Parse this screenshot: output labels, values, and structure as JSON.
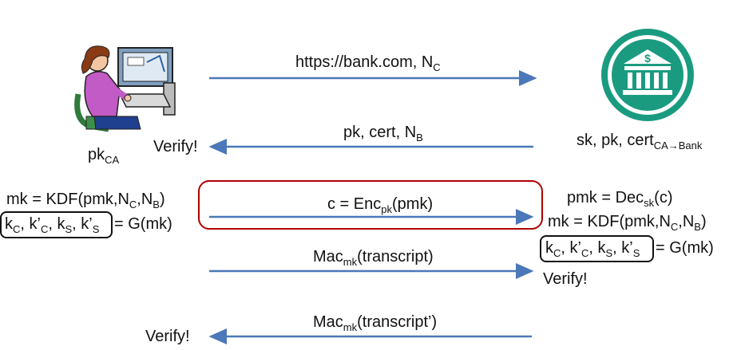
{
  "client": {
    "key_base": "pk",
    "key_sub": "CA",
    "verify_label": "Verify!",
    "mk_expr": {
      "pre": "mk = KDF(pmk,N",
      "s1": "C",
      "mid": ",N",
      "s2": "B",
      "post": ")"
    },
    "keys_expr": {
      "k1": "k",
      "k1s": "C",
      "k2": ", k’",
      "k2s": "C",
      "k3": ", k",
      "k3s": "S",
      "k4": ", k’",
      "k4s": "S",
      "rest": "= G(mk)"
    },
    "final_verify_label": "Verify!"
  },
  "bank": {
    "keys_label": {
      "pre": "sk, pk, cert",
      "sub": "CA→Bank"
    },
    "pmk_expr": {
      "pre": "pmk = Dec",
      "sub": "sk",
      "post": "(c)"
    },
    "mk_expr": {
      "pre": "mk = KDF(pmk,N",
      "s1": "C",
      "mid": ",N",
      "s2": "B",
      "post": ")"
    },
    "keys_expr": {
      "k1": "k",
      "k1s": "C",
      "k2": ", k’",
      "k2s": "C",
      "k3": ", k",
      "k3s": "S",
      "k4": ", k’",
      "k4s": "S",
      "rest": "= G(mk)"
    },
    "verify_label": "Verify!"
  },
  "messages": [
    {
      "dir": "right",
      "text": {
        "pre": "https://bank.com, N",
        "sub": "C",
        "post": ""
      }
    },
    {
      "dir": "left",
      "text": {
        "pre": "pk, cert, N",
        "sub": "B",
        "post": ""
      }
    },
    {
      "dir": "right",
      "text": {
        "pre": "c = Enc",
        "sub": "pk",
        "post": "(pmk)"
      }
    },
    {
      "dir": "right",
      "text": {
        "pre": "Mac",
        "sub": "mk",
        "post": "(transcript)"
      }
    },
    {
      "dir": "left",
      "text": {
        "pre": "Mac",
        "sub": "mk",
        "post": "(transcript’)"
      }
    }
  ],
  "colors": {
    "arrow": "#4a78b8",
    "highlight": "#b00000",
    "bank_icon": "#1a9b80"
  },
  "icons": {
    "client": "person-at-computer-icon",
    "bank": "bank-building-icon"
  }
}
